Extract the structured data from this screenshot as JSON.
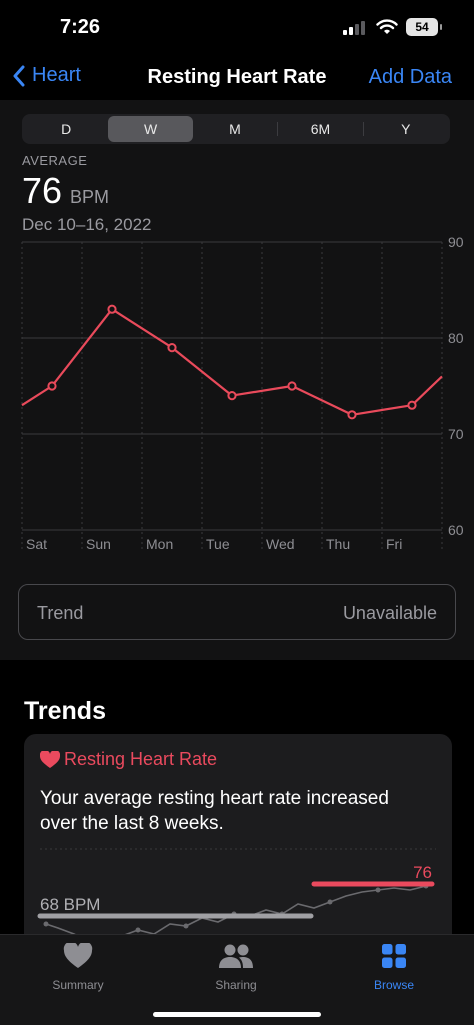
{
  "status": {
    "time": "7:26",
    "battery": "54"
  },
  "nav": {
    "back_label": "Heart",
    "title": "Resting Heart Rate",
    "action_label": "Add Data"
  },
  "segments": [
    "D",
    "W",
    "M",
    "6M",
    "Y"
  ],
  "selected_segment": "W",
  "summary": {
    "avg_label": "AVERAGE",
    "value": "76",
    "unit": "BPM",
    "range": "Dec 10–16, 2022"
  },
  "chart_data": {
    "type": "line",
    "categories": [
      "Sat",
      "Sun",
      "Mon",
      "Tue",
      "Wed",
      "Thu",
      "Fri"
    ],
    "series": [
      {
        "values": [
          75,
          83,
          79,
          74,
          75,
          72,
          73
        ]
      }
    ],
    "trailing_value": 76,
    "leading_value": 73,
    "ylim": [
      60,
      90
    ],
    "yticks": [
      90,
      80,
      70,
      60
    ],
    "line_color": "#e94a5b"
  },
  "trend": {
    "label": "Trend",
    "value": "Unavailable"
  },
  "trends_section": {
    "title": "Trends",
    "card_title": "Resting Heart Rate",
    "card_text": "Your average resting heart rate increased over the last 8 weeks.",
    "old_label": "68 BPM",
    "new_label": "76",
    "accent_color": "#ea4a5e"
  },
  "tabs": [
    {
      "label": "Summary",
      "icon": "heart-icon",
      "active": false
    },
    {
      "label": "Sharing",
      "icon": "people-icon",
      "active": false
    },
    {
      "label": "Browse",
      "icon": "grid-icon",
      "active": true
    }
  ]
}
